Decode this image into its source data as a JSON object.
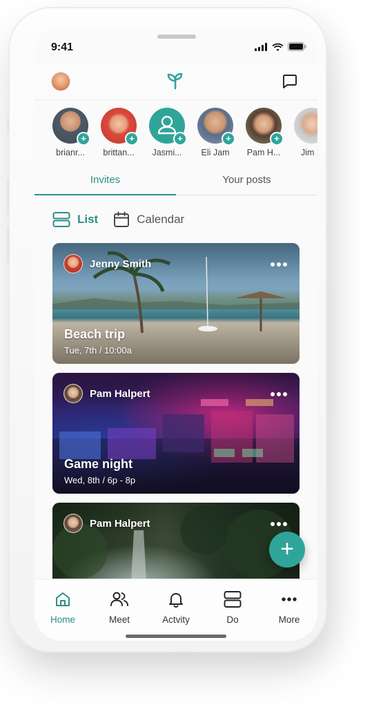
{
  "status_bar": {
    "time": "9:41"
  },
  "top_bar": {
    "logo_icon": "sprout-icon",
    "chat_icon": "chat-bubble-icon"
  },
  "stories": [
    {
      "name": "brianr...",
      "avatar_color": "#5b6b7a"
    },
    {
      "name": "brittan...",
      "avatar_color": "#e0564a"
    },
    {
      "name": "Jasmi...",
      "avatar_color": "#2fa59a"
    },
    {
      "name": "Eli Jam",
      "avatar_color": "#8a7766"
    },
    {
      "name": "Pam H...",
      "avatar_color": "#6b5a4d"
    },
    {
      "name": "Jim H",
      "avatar_color": "#b7b7b7"
    }
  ],
  "tabs": {
    "invites": "Invites",
    "your_posts": "Your posts"
  },
  "view_toggle": {
    "list": "List",
    "calendar": "Calendar"
  },
  "cards": [
    {
      "author": "Jenny Smith",
      "title": "Beach trip",
      "when": "Tue, 7th  /  10:00a"
    },
    {
      "author": "Pam Halpert",
      "title": "Game night",
      "when": "Wed, 8th  /  6p - 8p"
    },
    {
      "author": "Pam Halpert",
      "title": "",
      "when": ""
    }
  ],
  "fab": {
    "label": "+"
  },
  "bottom_nav": [
    {
      "label": "Home"
    },
    {
      "label": "Meet"
    },
    {
      "label": "Actvity"
    },
    {
      "label": "Do"
    },
    {
      "label": "More"
    }
  ],
  "colors": {
    "accent": "#2a8f86",
    "fab": "#2fa59a"
  }
}
